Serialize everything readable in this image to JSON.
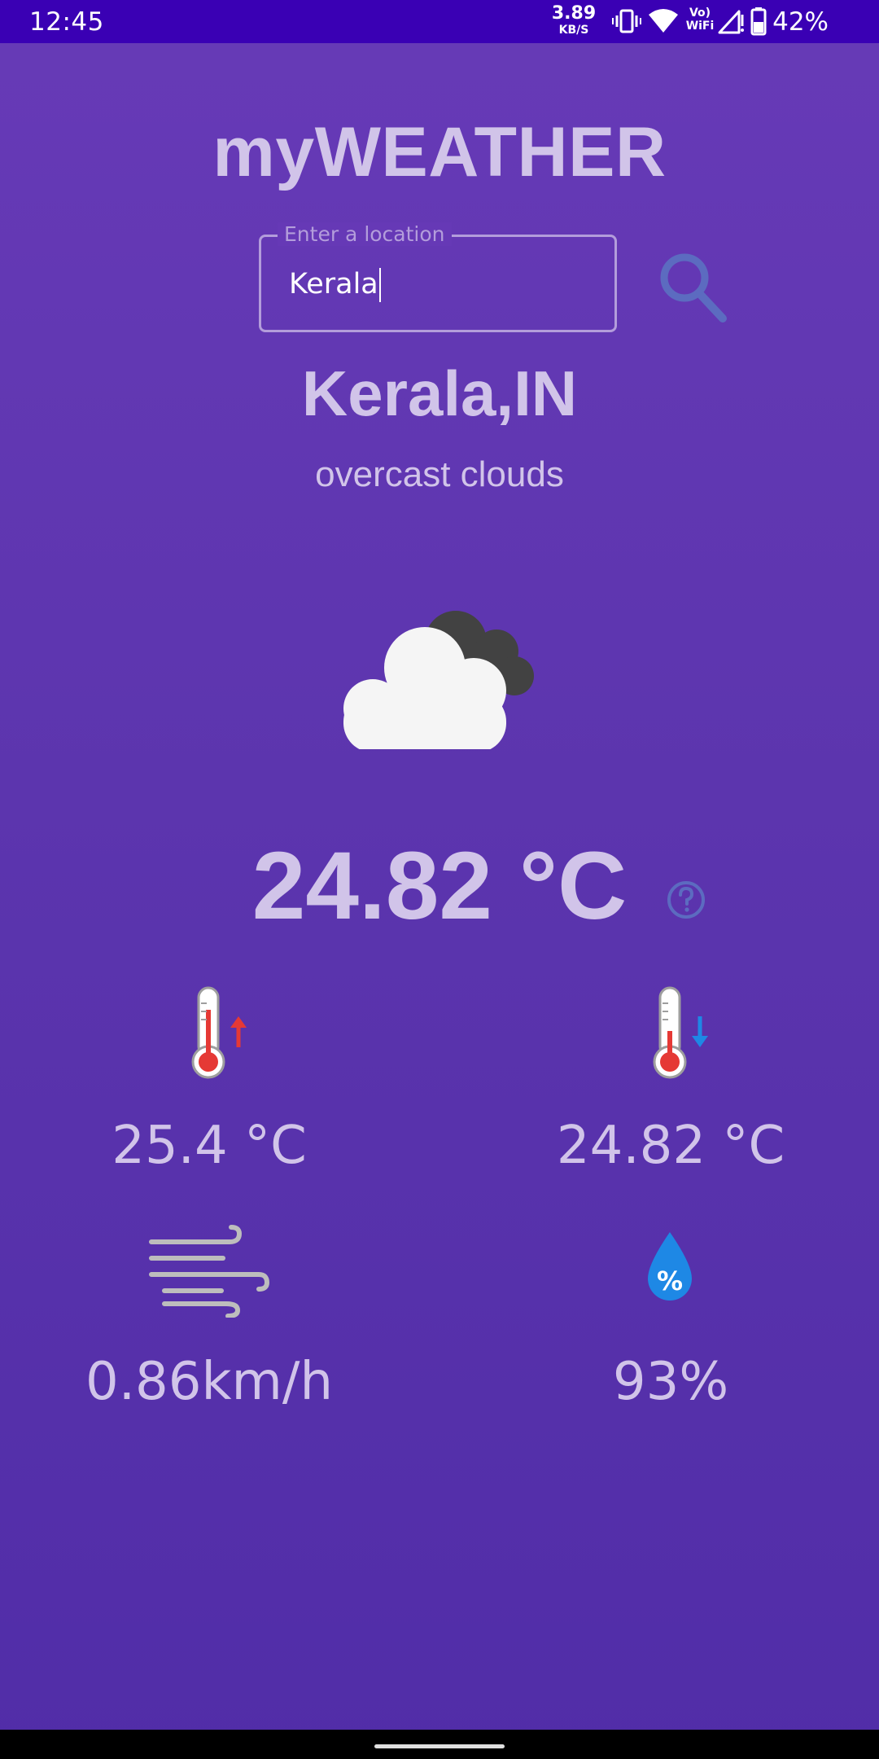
{
  "status_bar": {
    "time": "12:45",
    "net_speed_value": "3.89",
    "net_speed_unit": "KB/S",
    "battery_percent": "42%",
    "icons": [
      "vibrate-icon",
      "wifi-icon",
      "vowifi-icon",
      "signal-icon",
      "battery-icon"
    ],
    "vowifi_label_top": "Vo)",
    "vowifi_label_bottom": "WiFi"
  },
  "app": {
    "title": "myWEATHER"
  },
  "search": {
    "label": "Enter a location",
    "value": "Kerala",
    "icon": "search-icon"
  },
  "location": {
    "city": "Kerala,IN",
    "description": "overcast clouds",
    "condition_icon": "overcast-cloud-icon"
  },
  "current": {
    "temperature": "24.82 °C",
    "help_icon": "help-circle-icon"
  },
  "stats": {
    "max_temp": "25.4 °C",
    "min_temp": "24.82 °C",
    "wind_speed": "0.86km/h",
    "humidity": "93%",
    "humidity_icon_label": "%"
  },
  "colors": {
    "status_bar": "#3a00b4",
    "background_top": "#673ab7",
    "background_bottom": "#512da8",
    "text": "#d1c4e9",
    "accent": "#5c6bc0",
    "field_border": "#b39ddb",
    "arrow_up": "#e53935",
    "arrow_down": "#1e88e5"
  }
}
